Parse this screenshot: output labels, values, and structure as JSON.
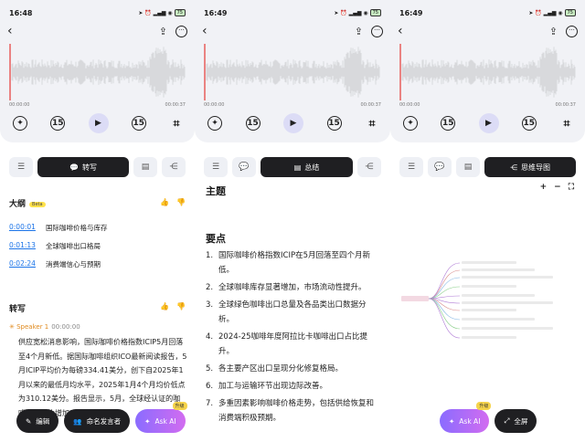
{
  "screens": [
    {
      "status_time": "16:48",
      "battery": "75",
      "timeline": {
        "start": "00:00:00",
        "end": "00:00:37"
      },
      "tabs": [
        {
          "icon": "list-icon",
          "label": ""
        },
        {
          "icon": "chat-icon",
          "label": "转写",
          "active": true
        },
        {
          "icon": "doc-icon",
          "label": ""
        },
        {
          "icon": "mindmap-icon",
          "label": ""
        }
      ],
      "outline": {
        "title": "大纲",
        "badge": "Beta",
        "items": [
          {
            "time": "0:00:01",
            "text": "国际咖啡价格与库存"
          },
          {
            "time": "0:01:13",
            "text": "全球咖啡出口格局"
          },
          {
            "time": "0:02:24",
            "text": "消费端信心与预期"
          }
        ]
      },
      "transcript": {
        "title": "转写",
        "speaker": "Speaker 1",
        "speaker_time": "00:00:00",
        "text": "供应宽松消息影响，国际咖啡价格指数ICIP5月回落至4个月新低。据国际咖啡组织ICO最新阅读报告，5月ICIP平均价为每磅334.41美分，创下自2025年1月以来的最低月均水平，2025年1月4个月均价低点为310.12美分。报告显示，5月，全球经认证的咖啡库存环比增加28.1%，"
      },
      "bottom": {
        "edit": "编辑",
        "speakers": "命名发言者",
        "ai": "Ask AI",
        "upgrade": "升级"
      }
    },
    {
      "status_time": "16:49",
      "battery": "75",
      "timeline": {
        "start": "00:00:00",
        "end": "00:00:37"
      },
      "tabs": [
        {
          "icon": "list-icon",
          "label": ""
        },
        {
          "icon": "chat-icon",
          "label": ""
        },
        {
          "icon": "doc-icon",
          "label": "总结",
          "active": true
        },
        {
          "icon": "mindmap-icon",
          "label": ""
        }
      ],
      "summary": {
        "theme_title": "主题",
        "points_title": "要点",
        "points": [
          "国际咖啡价格指数ICIP在5月回落至四个月新低。",
          "全球咖啡库存显著增加，市场流动性提升。",
          "全球绿色咖啡出口总量及各品类出口数据分析。",
          "2024-25咖啡年度阿拉比卡咖啡出口占比提升。",
          "各主要产区出口呈现分化修复格局。",
          "加工与运输环节出现边际改善。",
          "多重因素影响咖啡价格走势，包括供给恢复和消费端积极预期。"
        ]
      }
    },
    {
      "status_time": "16:49",
      "battery": "75",
      "timeline": {
        "start": "00:00:00",
        "end": "00:00:37"
      },
      "tabs": [
        {
          "icon": "list-icon",
          "label": ""
        },
        {
          "icon": "chat-icon",
          "label": ""
        },
        {
          "icon": "doc-icon",
          "label": ""
        },
        {
          "icon": "mindmap-icon",
          "label": "思维导图",
          "active": true
        }
      ],
      "mindmap": {
        "zoom_in": "+",
        "zoom_out": "−"
      },
      "bottom": {
        "ai": "Ask AI",
        "upgrade": "升级",
        "fullscreen": "全屏"
      }
    }
  ]
}
